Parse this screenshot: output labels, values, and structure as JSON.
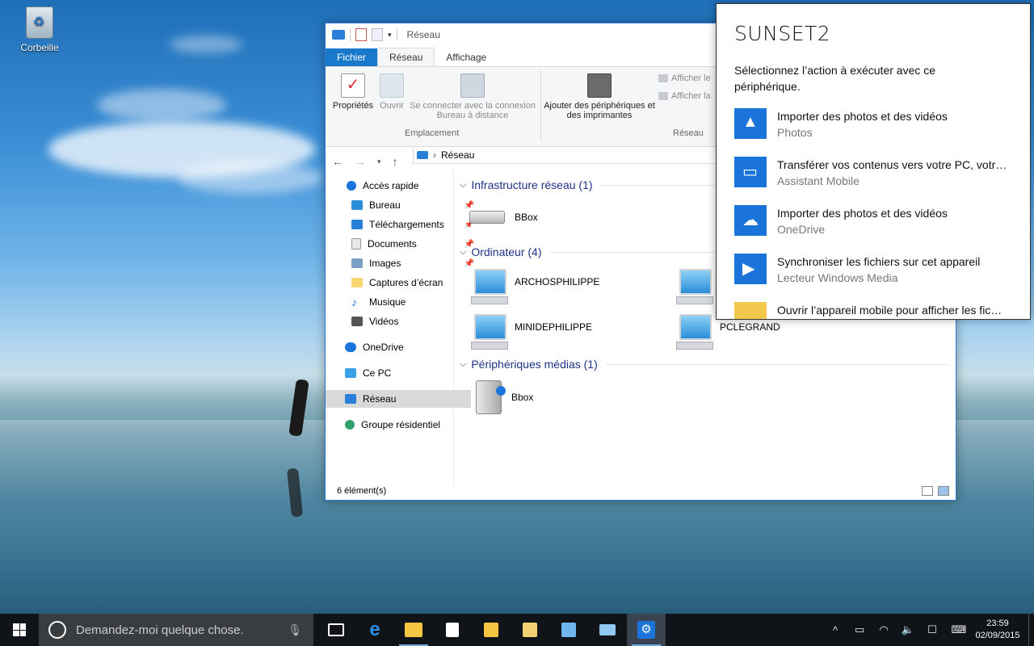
{
  "desktop": {
    "recycle_bin_label": "Corbeille"
  },
  "explorer": {
    "title": "Réseau",
    "tabs": [
      "Fichier",
      "Réseau",
      "Affichage"
    ],
    "ribbon": {
      "properties": "Propriétés",
      "open": "Ouvrir",
      "remote_connect": "Se connecter avec la connexion Bureau à distance",
      "add_devices": "Ajouter des périphériques et des imprimantes",
      "show_1": "Afficher le",
      "show_2": "Afficher la",
      "group_location": "Emplacement",
      "group_network": "Réseau"
    },
    "address": "Réseau",
    "nav": {
      "quick_access": "Accès rapide",
      "desktop": "Bureau",
      "downloads": "Téléchargements",
      "documents": "Documents",
      "images": "Images",
      "screenshots": "Captures d’écran",
      "music": "Musique",
      "videos": "Vidéos",
      "onedrive": "OneDrive",
      "this_pc": "Ce PC",
      "network": "Réseau",
      "homegroup": "Groupe résidentiel"
    },
    "groups": {
      "infra": "Infrastructure réseau (1)",
      "computers": "Ordinateur (4)",
      "media": "Périphériques médias (1)"
    },
    "items": {
      "bbox_router": "BBox",
      "pc1": "ARCHOSPHILIPPE",
      "pc2": "",
      "pc3": "MINIDEPHILIPPE",
      "pc4": "PCLEGRAND",
      "bbox_media": "Bbox"
    },
    "status": "6 élément(s)"
  },
  "autoplay": {
    "title": "SUNSET2",
    "description": "Sélectionnez l’action à exécuter avec ce périphérique.",
    "options": [
      {
        "title": "Importer des photos et des vidéos",
        "subtitle": "Photos"
      },
      {
        "title": "Transférer vos contenus vers votre PC, votr…",
        "subtitle": "Assistant Mobile"
      },
      {
        "title": "Importer des photos et des vidéos",
        "subtitle": "OneDrive"
      },
      {
        "title": "Synchroniser les fichiers sur cet appareil",
        "subtitle": "Lecteur Windows Media"
      },
      {
        "title": "Ouvrir l’appareil mobile pour afficher les fic…",
        "subtitle": ""
      }
    ]
  },
  "taskbar": {
    "search_placeholder": "Demandez-moi quelque chose.",
    "time": "23:59",
    "date": "02/09/2015"
  },
  "colors": {
    "accent": "#1a74d9",
    "taskbar": "#101418"
  }
}
